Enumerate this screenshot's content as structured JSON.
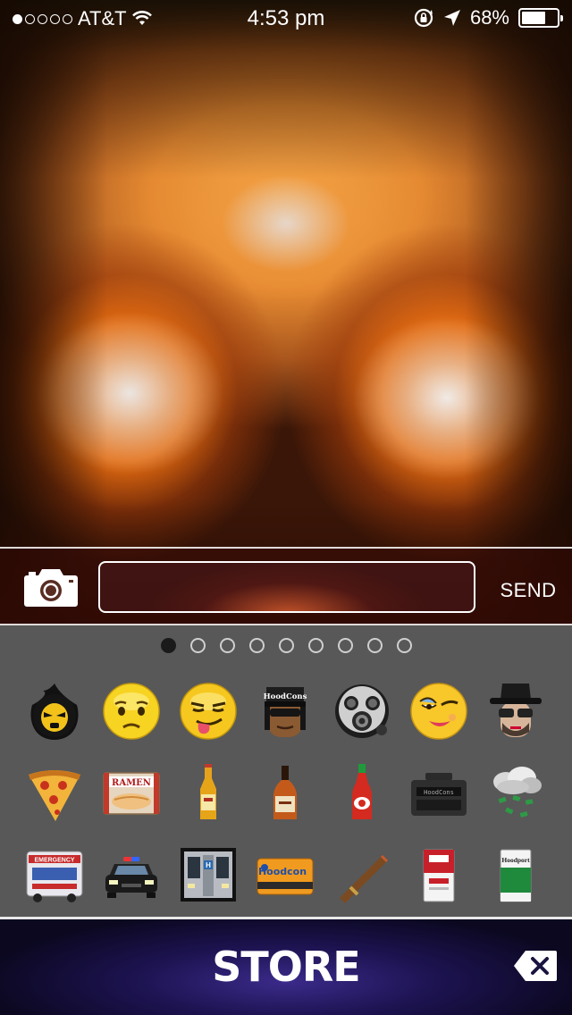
{
  "status_bar": {
    "signal_dots_on": 1,
    "signal_dots_total": 5,
    "carrier": "AT&T",
    "time": "4:53 pm",
    "battery_percent": "68%",
    "battery_level": 0.68,
    "icons": [
      "wifi-icon",
      "rotation-lock-icon",
      "location-arrow-icon",
      "battery-icon"
    ]
  },
  "compose": {
    "camera_icon": "camera-icon",
    "input_value": "",
    "input_placeholder": "",
    "send_label": "SEND"
  },
  "emoji_panel": {
    "page_count": 9,
    "active_page": 0,
    "rows": [
      [
        "ninja-face",
        "sad-face",
        "tongue-out-face",
        "hoodcons-cap-face",
        "gas-mask-face",
        "winking-lady-face",
        "hat-sunglasses-face"
      ],
      [
        "pizza-slice",
        "ramen-box",
        "beer-bottle",
        "liquor-bottle",
        "hot-sauce-bottle",
        "boombox",
        "money-rain-cloud"
      ],
      [
        "ambulance",
        "police-car",
        "subway-train",
        "hoodcon-card",
        "cigar",
        "cigarette-pack-red",
        "cigarette-pack-green"
      ]
    ],
    "ramen_text": "RAMEN",
    "hoodcon_text": "Hoodcon",
    "emergency_text": "EMERGENCY",
    "hoodcons_text": "HoodCons",
    "hoodport_text": "Hoodport"
  },
  "store_bar": {
    "store_label": "STORE",
    "delete_icon": "delete-backspace-icon"
  }
}
